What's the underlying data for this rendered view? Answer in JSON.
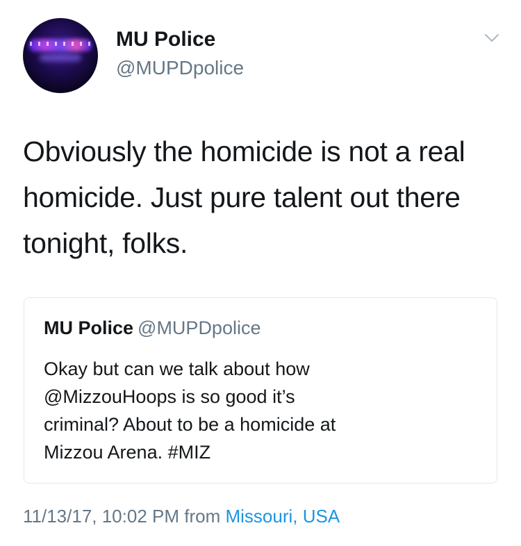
{
  "author": {
    "name": "MU Police",
    "handle": "@MUPDpolice",
    "avatar_icon": "police-lights-avatar"
  },
  "tweet": {
    "text_lines": [
      "Obviously the homicide is not a real",
      "homicide. Just pure talent out there",
      "tonight, folks."
    ]
  },
  "quoted_tweet": {
    "name": "MU Police",
    "handle": "@MUPDpolice",
    "text_lines": [
      "Okay but can we talk about how",
      "@MizzouHoops is so good it’s",
      "criminal? About to be a homicide at",
      "Mizzou Arena. #MIZ"
    ]
  },
  "meta": {
    "timestamp": "11/13/17, 10:02 PM",
    "from_label": "from",
    "location": "Missouri, USA"
  },
  "colors": {
    "text": "#14171a",
    "secondary": "#657786",
    "link": "#1b95e0",
    "border": "#e1e8ed"
  }
}
